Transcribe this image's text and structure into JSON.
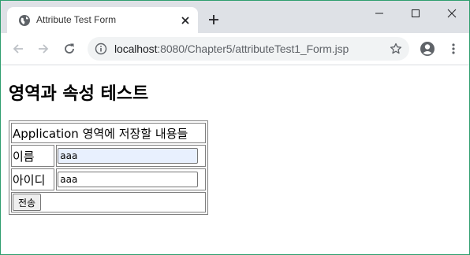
{
  "browser": {
    "tab_title": "Attribute Test Form",
    "url_host": "localhost",
    "url_path": ":8080/Chapter5/attributeTest1_Form.jsp",
    "icons": {
      "favicon": "globe-icon",
      "tab_close": "close-icon",
      "new_tab": "plus-icon",
      "back": "back-arrow-icon",
      "forward": "forward-arrow-icon",
      "reload": "reload-icon",
      "site_info": "info-icon",
      "bookmark": "star-icon",
      "profile": "profile-icon",
      "menu": "kebab-menu-icon",
      "minimize": "minimize-icon",
      "maximize": "maximize-icon",
      "close_window": "close-window-icon"
    },
    "accent_border": "#2f9e6e"
  },
  "page": {
    "heading": "영역과 속성 테스트",
    "form": {
      "caption": "Application 영역에 저장할 내용들",
      "name_label": "이름",
      "name_value": "aaa",
      "id_label": "아이디",
      "id_value": "aaa",
      "submit_label": "전송",
      "autofill_color": "#e8f0fe"
    }
  }
}
